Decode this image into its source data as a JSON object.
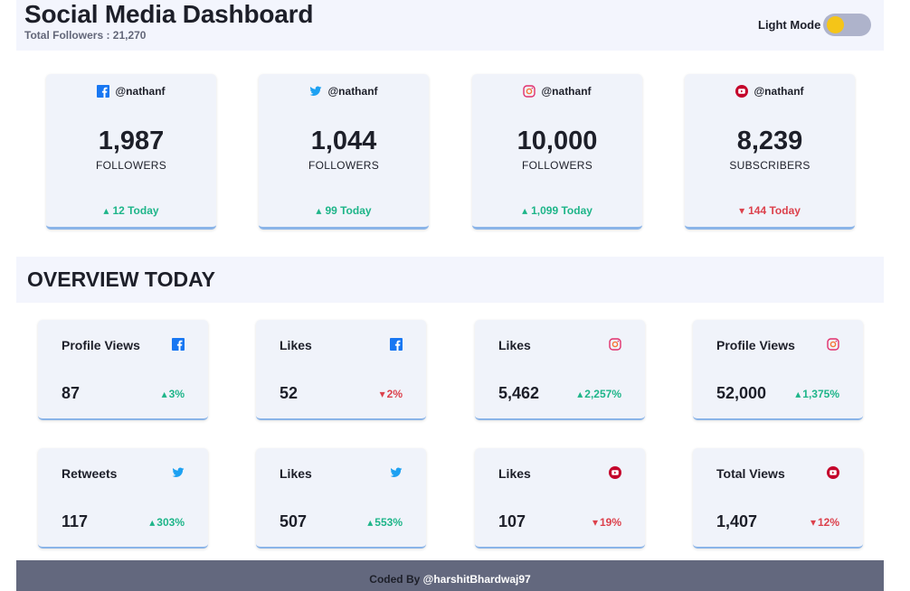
{
  "header": {
    "title": "Social Media Dashboard",
    "total_followers": "Total Followers : 21,270",
    "mode_label": "Light Mode"
  },
  "cards": [
    {
      "platform": "facebook",
      "icon": "facebook-icon",
      "handle": "@nathanf",
      "count": "1,987",
      "unit": "FOLLOWERS",
      "today": "12 Today",
      "trend": "up"
    },
    {
      "platform": "twitter",
      "icon": "twitter-icon",
      "handle": "@nathanf",
      "count": "1,044",
      "unit": "FOLLOWERS",
      "today": "99 Today",
      "trend": "up"
    },
    {
      "platform": "instagram",
      "icon": "instagram-icon",
      "handle": "@nathanf",
      "count": "10,000",
      "unit": "FOLLOWERS",
      "today": "1,099 Today",
      "trend": "up"
    },
    {
      "platform": "youtube",
      "icon": "youtube-icon",
      "handle": "@nathanf",
      "count": "8,239",
      "unit": "SUBSCRIBERS",
      "today": "144 Today",
      "trend": "down"
    }
  ],
  "overview": {
    "title": "OVERVIEW TODAY",
    "tiles": [
      {
        "label": "Profile Views",
        "icon": "facebook-icon",
        "value": "87",
        "change": "3%",
        "trend": "up"
      },
      {
        "label": "Likes",
        "icon": "facebook-icon",
        "value": "52",
        "change": "2%",
        "trend": "down"
      },
      {
        "label": "Likes",
        "icon": "instagram-icon",
        "value": "5,462",
        "change": "2,257%",
        "trend": "up"
      },
      {
        "label": "Profile Views",
        "icon": "instagram-icon",
        "value": "52,000",
        "change": "1,375%",
        "trend": "up"
      },
      {
        "label": "Retweets",
        "icon": "twitter-icon",
        "value": "117",
        "change": "303%",
        "trend": "up"
      },
      {
        "label": "Likes",
        "icon": "twitter-icon",
        "value": "507",
        "change": "553%",
        "trend": "up"
      },
      {
        "label": "Likes",
        "icon": "youtube-icon",
        "value": "107",
        "change": "19%",
        "trend": "down"
      },
      {
        "label": "Total Views",
        "icon": "youtube-icon",
        "value": "1,407",
        "change": "12%",
        "trend": "down"
      }
    ]
  },
  "footer": {
    "prefix": "Coded By ",
    "author": "@harshitBhardwaj97"
  },
  "colors": {
    "up": "#1eb589",
    "down": "#dc414c",
    "facebook": "#1877f2",
    "twitter": "#1da1f2",
    "instagram": "#e1306c",
    "youtube": "#c4032b"
  }
}
